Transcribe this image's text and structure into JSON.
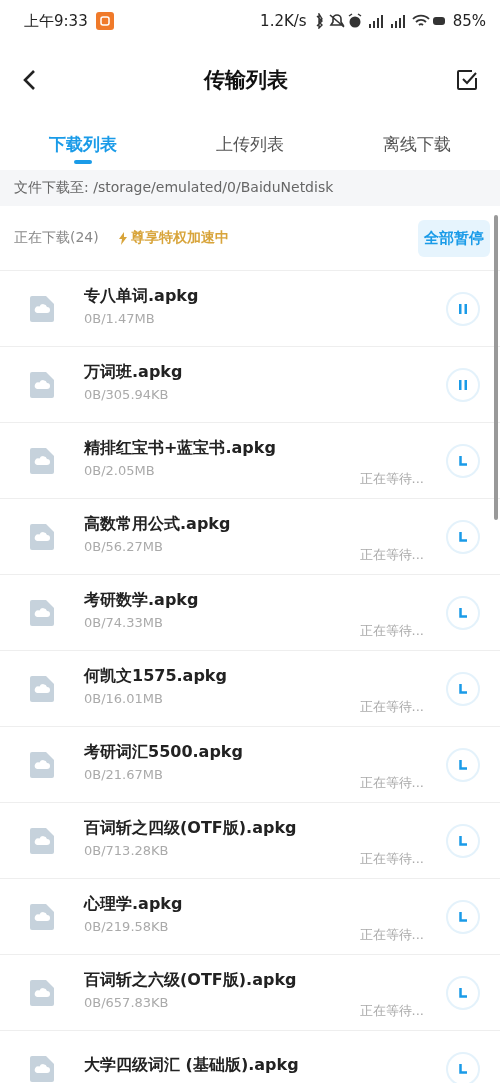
{
  "status_bar": {
    "time": "上午9:33",
    "speed": "1.2K/s",
    "battery": "85%"
  },
  "header": {
    "title": "传输列表"
  },
  "tabs": [
    {
      "label": "下载列表",
      "selected": true
    },
    {
      "label": "上传列表",
      "selected": false
    },
    {
      "label": "离线下载",
      "selected": false
    }
  ],
  "path": "文件下载至: /storage/emulated/0/BaiduNetdisk",
  "summary": {
    "count": "正在下载(24)",
    "boost": "尊享特权加速中",
    "action": "全部暂停"
  },
  "files": [
    {
      "name": "专八单词.apkg",
      "size": "0B/1.47MB",
      "kind": "downloading"
    },
    {
      "name": "万词班.apkg",
      "size": "0B/305.94KB",
      "kind": "downloading"
    },
    {
      "name": "精排红宝书+蓝宝书.apkg",
      "size": "0B/2.05MB",
      "kind": "waiting",
      "status": "正在等待..."
    },
    {
      "name": "高数常用公式.apkg",
      "size": "0B/56.27MB",
      "kind": "waiting",
      "status": "正在等待..."
    },
    {
      "name": "考研数学.apkg",
      "size": "0B/74.33MB",
      "kind": "waiting",
      "status": "正在等待..."
    },
    {
      "name": "何凯文1575.apkg",
      "size": "0B/16.01MB",
      "kind": "waiting",
      "status": "正在等待..."
    },
    {
      "name": "考研词汇5500.apkg",
      "size": "0B/21.67MB",
      "kind": "waiting",
      "status": "正在等待..."
    },
    {
      "name": "百词斩之四级(OTF版).apkg",
      "size": "0B/713.28KB",
      "kind": "waiting",
      "status": "正在等待..."
    },
    {
      "name": "心理学.apkg",
      "size": "0B/219.58KB",
      "kind": "waiting",
      "status": "正在等待..."
    },
    {
      "name": "百词斩之六级(OTF版).apkg",
      "size": "0B/657.83KB",
      "kind": "waiting",
      "status": "正在等待..."
    },
    {
      "name": "大学四级词汇 (基础版).apkg",
      "kind": "waiting"
    }
  ]
}
